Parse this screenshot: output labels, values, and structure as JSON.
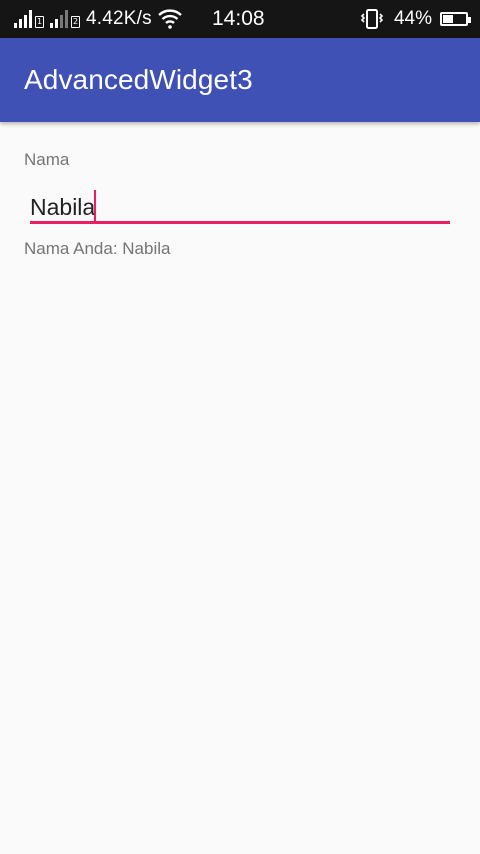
{
  "status_bar": {
    "sim1_label": "1",
    "sim2_label": "2",
    "net_speed": "4.42K/s",
    "clock": "14:08",
    "battery_percent": "44%",
    "battery_level": 0.44,
    "icons": [
      "signal-icon",
      "wifi-icon",
      "vibrate-icon",
      "battery-icon"
    ]
  },
  "app_bar": {
    "title": "AdvancedWidget3",
    "color": "#3f51b5"
  },
  "form": {
    "name_label": "Nama",
    "name_value": "Nabila",
    "accent_color": "#e91e63",
    "output_text": "Nama Anda: Nabila"
  }
}
